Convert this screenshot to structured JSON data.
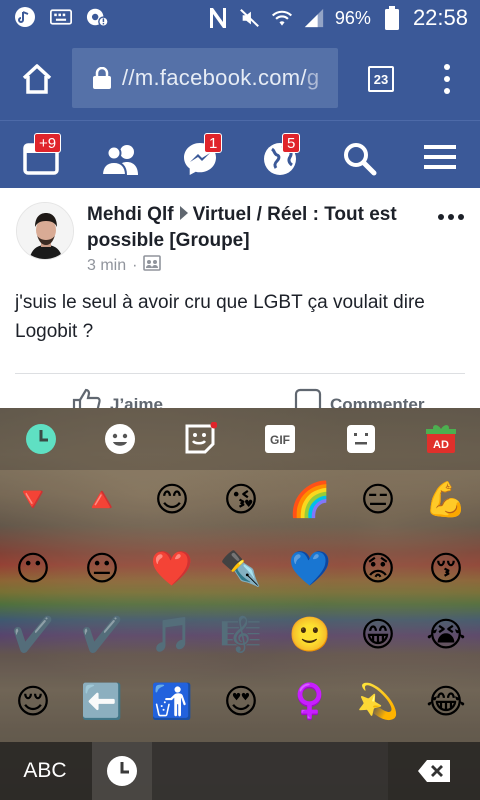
{
  "status_bar": {
    "battery_percent": "96%",
    "time": "22:58",
    "icons": [
      "music-icon",
      "keyboard-icon",
      "settings-alert-icon",
      "nfc-icon",
      "mute-icon",
      "wifi-icon",
      "signal-icon",
      "battery-icon"
    ]
  },
  "browser": {
    "url_visible": "//m.facebook.com/",
    "url_cut": "g",
    "tab_count": "23",
    "icons": [
      "home-icon",
      "lock-icon",
      "tabs-icon",
      "overflow-menu-icon"
    ]
  },
  "fb_nav": {
    "feed_badge": "+9",
    "messages_badge": "1",
    "notifications_badge": "5",
    "icons": [
      "news-feed-icon",
      "friends-icon",
      "messenger-icon",
      "globe-icon",
      "search-icon",
      "hamburger-menu-icon"
    ]
  },
  "post": {
    "author": "Mehdi Qlf",
    "group": "Virtuel / Réel : Tout est possible [Groupe]",
    "time": "3 min",
    "separator": "·",
    "body": "j'suis le seul à avoir cru que LGBT ça voulait dire Logobit ?",
    "like_label": "J’aime",
    "comment_label": "Commenter"
  },
  "keyboard": {
    "categories": [
      "recent",
      "smileys",
      "stickers",
      "gif",
      "emoticons",
      "ads"
    ],
    "gif_label": "GIF",
    "ad_label": "AD",
    "emoji_rows": [
      [
        "🔻",
        "🔺",
        "😊",
        "😘",
        "🌈",
        "😑",
        "💪"
      ],
      [
        "😶",
        "😐",
        "❤️",
        "✒️",
        "💙",
        "😟",
        "😚"
      ],
      [
        "✔️",
        "✔️",
        "🎵",
        "🎼",
        "🙂",
        "😁",
        "😭"
      ],
      [
        "😌",
        "⬅️",
        "🚮",
        "😍",
        "♀️",
        "💫",
        "😂"
      ]
    ],
    "abc_label": "ABC"
  },
  "colors": {
    "fb_blue": "#3b5998",
    "badge_red": "#e0242b",
    "recent_teal": "#5fe0c3"
  }
}
